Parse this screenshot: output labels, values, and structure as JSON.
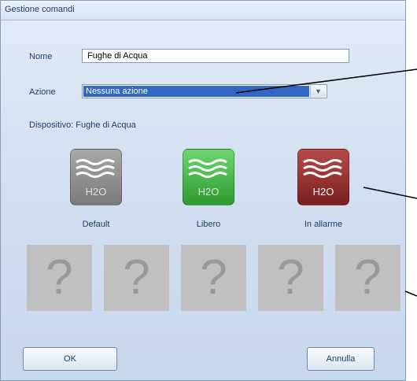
{
  "window": {
    "title": "Gestione comandi"
  },
  "form": {
    "name_label": "Nome",
    "name_value": "Fughe di Acqua",
    "action_label": "Azione",
    "action_value": "Nessuna azione",
    "device_text": "Dispositivo: Fughe di Acqua"
  },
  "states": [
    {
      "label": "Default",
      "badge": "H2O",
      "color": "#8c8c8c"
    },
    {
      "label": "Libero",
      "badge": "H2O",
      "color": "#3fa83f"
    },
    {
      "label": "In allarme",
      "badge": "H2O",
      "color": "#8e2a2a"
    }
  ],
  "placeholders": [
    "?",
    "?",
    "?",
    "?",
    "?"
  ],
  "buttons": {
    "ok": "OK",
    "cancel": "Annulla"
  }
}
